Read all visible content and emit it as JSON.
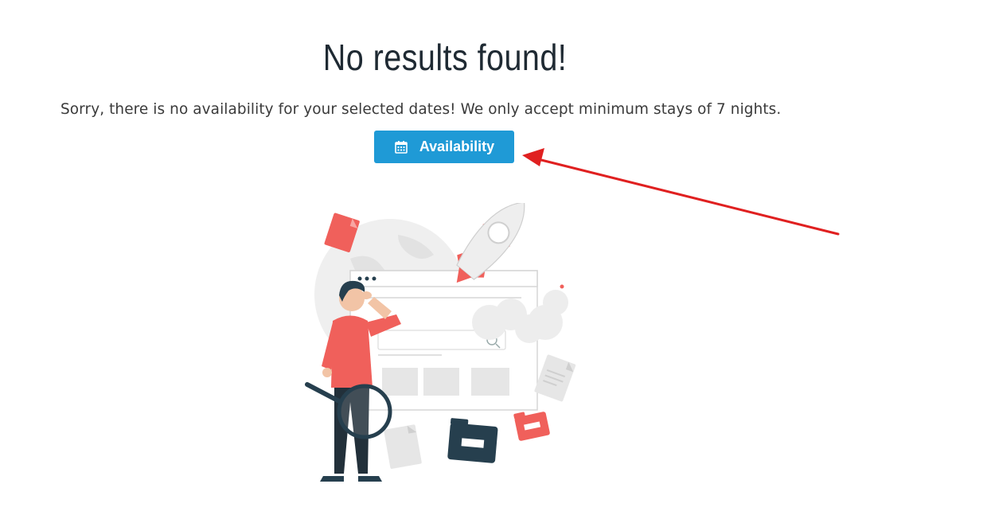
{
  "heading": "No results found!",
  "message": "Sorry, there is no availability for your selected dates! We only accept minimum stays of 7 nights.",
  "availability_button": {
    "label": "Availability",
    "icon": "calendar-icon"
  },
  "colors": {
    "button": "#1f9ad6",
    "arrow": "#e02020",
    "accent": "#f0605b",
    "dark": "#263f4e"
  }
}
